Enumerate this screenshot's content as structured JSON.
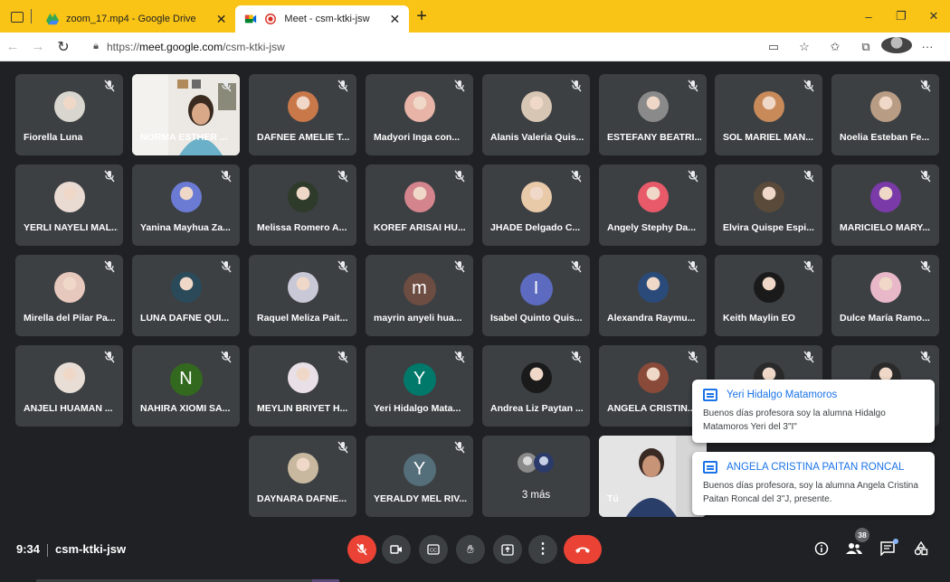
{
  "browser": {
    "tabs": [
      {
        "title": "zoom_17.mp4 - Google Drive",
        "icon": "google-drive-icon"
      },
      {
        "title": "Meet - csm-ktki-jsw",
        "icon": "google-meet-icon"
      }
    ],
    "url_prefix": "https://",
    "url_host": "meet.google.com",
    "url_path": "/csm-ktki-jsw"
  },
  "participants": [
    {
      "name": "Fiorella Luna",
      "color": "#d9d6cf"
    },
    {
      "name": "NORMA ESTHER ...",
      "video": true
    },
    {
      "name": "DAFNEE AMELIE T...",
      "color": "#c9784a"
    },
    {
      "name": "Madyori Inga con...",
      "color": "#e8b4a8"
    },
    {
      "name": "Alanis Valeria Quis...",
      "color": "#d8c6b4"
    },
    {
      "name": "ESTEFANY BEATRI...",
      "color": "#8a8a8a"
    },
    {
      "name": "SOL MARIEL MAN...",
      "color": "#c98a5a"
    },
    {
      "name": "Noelia Esteban Fe...",
      "color": "#b89c84"
    },
    {
      "name": "YERLI NAYELI MAL...",
      "color": "#e9dad2"
    },
    {
      "name": "Yanina Mayhua Za...",
      "color": "#6b7bd4"
    },
    {
      "name": "Melissa Romero A...",
      "color": "#2e3a2a"
    },
    {
      "name": "KOREF ARISAI HU...",
      "color": "#d4848c"
    },
    {
      "name": "JHADE Delgado C...",
      "color": "#e8c9a8"
    },
    {
      "name": "Angely Stephy Da...",
      "color": "#e85a6a"
    },
    {
      "name": "Elvira Quispe Espi...",
      "color": "#5a4a3a"
    },
    {
      "name": "MARICIELO MARY...",
      "color": "#7a3aa8"
    },
    {
      "name": "Mirella del Pilar Pa...",
      "color": "#e6c8bc"
    },
    {
      "name": "LUNA DAFNE QUI...",
      "color": "#2a4a5a"
    },
    {
      "name": "Raquel Meliza Pait...",
      "color": "#c8c8d6"
    },
    {
      "name": "mayrin anyeli hua...",
      "letter": "m",
      "color": "#6d4c41"
    },
    {
      "name": "Isabel Quinto Quis...",
      "letter": "I",
      "color": "#5c6bc0"
    },
    {
      "name": "Alexandra Raymu...",
      "color": "#2a4a7a"
    },
    {
      "name": "Keith Maylin EO",
      "color": "#1a1a1a"
    },
    {
      "name": "Dulce María Ramo...",
      "color": "#e8b8c8"
    },
    {
      "name": "ANJELI HUAMAN ...",
      "color": "#e8ded6"
    },
    {
      "name": "NAHIRA XIOMI SA...",
      "letter": "N",
      "color": "#33691e"
    },
    {
      "name": "MEYLIN BRIYET H...",
      "color": "#e8e0e6"
    },
    {
      "name": "Yeri Hidalgo Mata...",
      "letter": "Y",
      "color": "#00796b"
    },
    {
      "name": "Andrea Liz Paytan ...",
      "color": "#1a1a1a"
    },
    {
      "name": "ANGELA CRISTIN...",
      "color": "#8a4a3a"
    },
    {
      "name": "",
      "color": "#2a2a2a"
    },
    {
      "name": "",
      "color": "#2a2a2a"
    },
    {
      "name": "DAYNARA DAFNE...",
      "color": "#c8b8a0"
    },
    {
      "name": "YERALDY MEL RIV...",
      "letter": "Y",
      "color": "#546e7a"
    }
  ],
  "more_tile": {
    "label": "3 más"
  },
  "self_tile": {
    "label": "Tú"
  },
  "notifications": [
    {
      "sender": "Yeri Hidalgo Matamoros",
      "message": "Buenos días profesora soy la alumna Hidalgo Matamoros Yeri del 3\"I\""
    },
    {
      "sender": "ANGELA CRISTINA PAITAN RONCAL",
      "message": "Buenos días profesora, soy la alumna Angela Cristina Paitan Roncal del 3\"J, presente."
    }
  ],
  "bottom": {
    "time": "9:34",
    "meeting_code": "csm-ktki-jsw",
    "participant_count": "38"
  },
  "colors": {
    "background": "#202124",
    "tile": "#3c4043",
    "end_call": "#ea4335",
    "tabbar": "#f9c416",
    "accent": "#1a73e8"
  }
}
